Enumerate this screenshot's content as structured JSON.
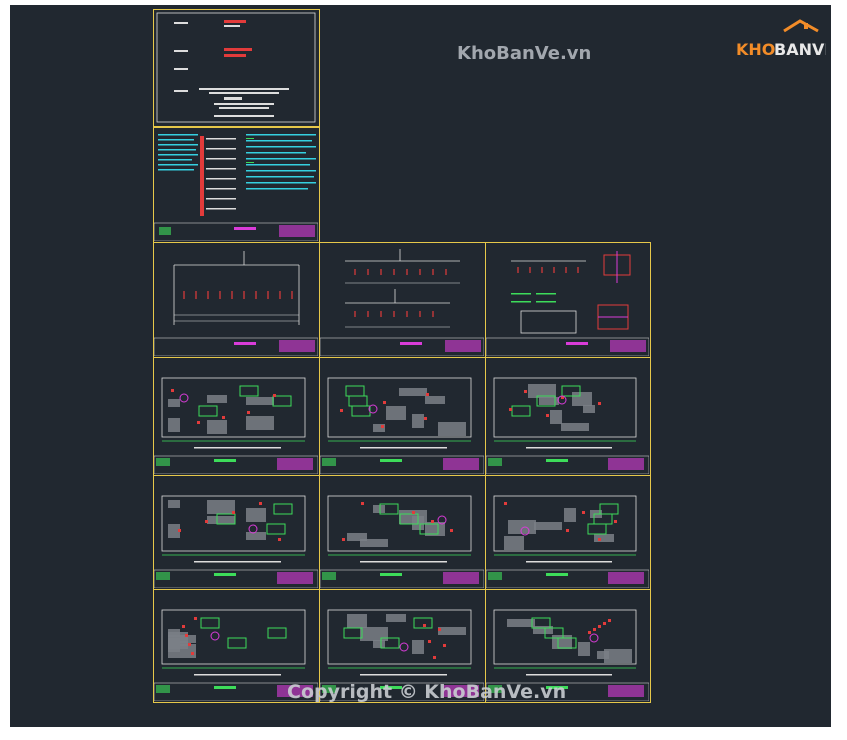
{
  "watermarks": {
    "top": "KhoBanVe.vn",
    "bottom": "Copyright © KhoBanVe.vn"
  },
  "logo": {
    "text": "KHOBANVE",
    "colors": {
      "kho": "#f28c28",
      "banve": "#e8e8e8"
    }
  },
  "cad_colors": {
    "background": "#212830",
    "frame": "#e6c84a",
    "magenta": "#d93cd9",
    "green": "#3ddc5a",
    "red": "#e23b3b",
    "cyan": "#35d0e0",
    "white": "#e8e8e8",
    "gray_fill": "#7a7f86"
  },
  "sheets": {
    "cover": {
      "kind": "cover"
    },
    "notes": {
      "kind": "notes"
    },
    "schematics": [
      "single-line-diagram",
      "riser-diagram",
      "wiring-details"
    ],
    "plans": [
      "plan-1",
      "plan-2",
      "plan-3",
      "plan-4",
      "plan-5",
      "plan-6",
      "plan-7",
      "plan-8",
      "plan-9"
    ]
  }
}
